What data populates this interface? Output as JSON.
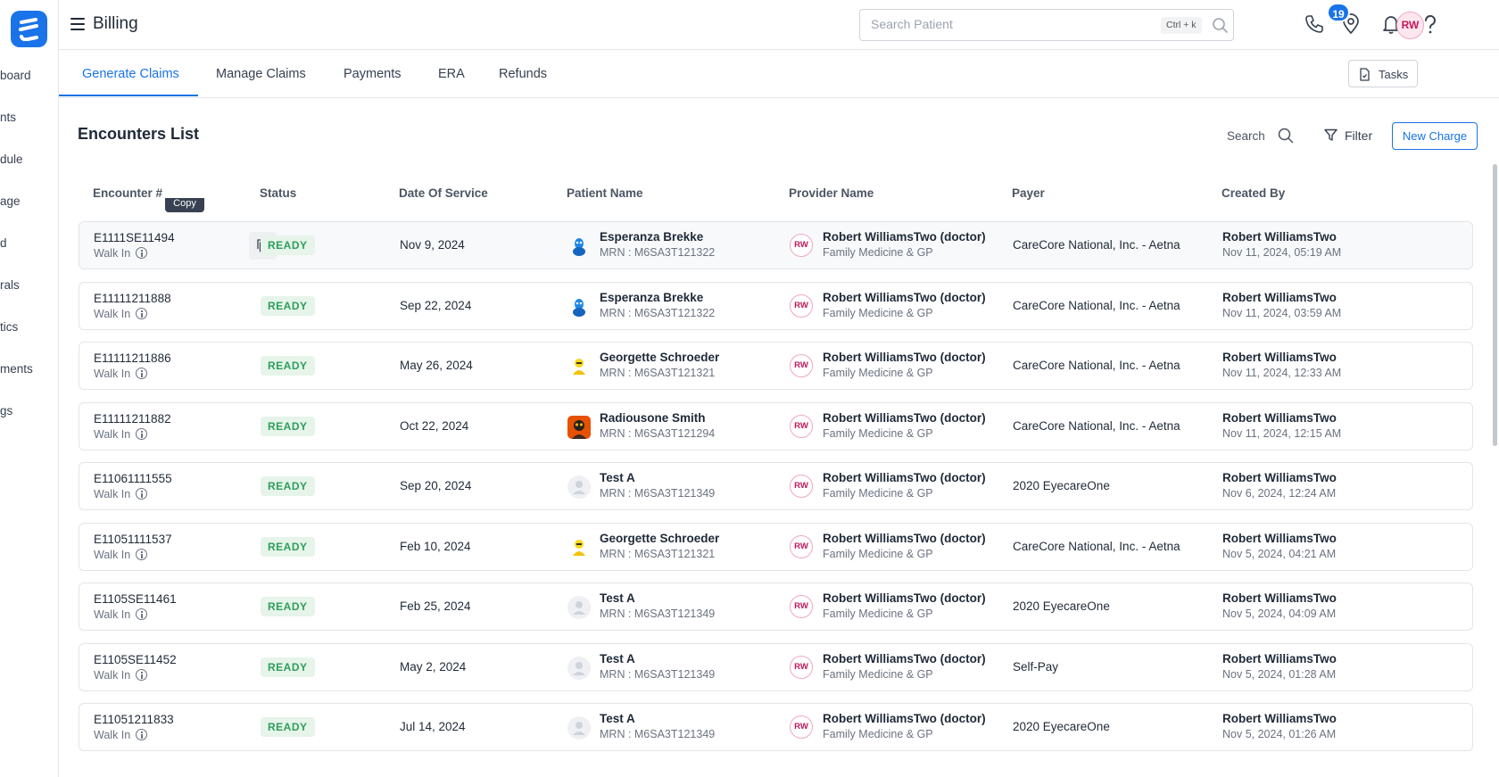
{
  "sidebar": {
    "items": [
      "board",
      "nts",
      "dule",
      "age",
      "d",
      "rals",
      "tics",
      "ments",
      "gs"
    ]
  },
  "header": {
    "title": "Billing",
    "search_placeholder": "Search Patient",
    "shortcut": "Ctrl + k",
    "notification_count": "19",
    "avatar_initials": "RW"
  },
  "tabs": [
    {
      "label": "Generate Claims",
      "active": true
    },
    {
      "label": "Manage Claims",
      "active": false
    },
    {
      "label": "Payments",
      "active": false
    },
    {
      "label": "ERA",
      "active": false
    },
    {
      "label": "Refunds",
      "active": false
    }
  ],
  "tasks_label": "Tasks",
  "list": {
    "title": "Encounters List",
    "search_label": "Search",
    "filter_label": "Filter",
    "new_charge_label": "New Charge",
    "tooltip": "Copy",
    "columns": [
      "Encounter #",
      "Status",
      "Date Of Service",
      "Patient Name",
      "Provider Name",
      "Payer",
      "Created By"
    ],
    "rows": [
      {
        "id": "E1111SE11494",
        "type": "Walk In",
        "status": "READY",
        "dos": "Nov 9, 2024",
        "patient": "Esperanza Brekke",
        "mrn": "MRN : M6SA3T121322",
        "avatar": "blue",
        "provider_initials": "RW",
        "provider": "Robert WilliamsTwo (doctor)",
        "specialty": "Family Medicine & GP",
        "payer": "CareCore National, Inc. - Aetna",
        "creator": "Robert WilliamsTwo",
        "created": "Nov 11, 2024, 05:19 AM"
      },
      {
        "id": "E11111211888",
        "type": "Walk In",
        "status": "READY",
        "dos": "Sep 22, 2024",
        "patient": "Esperanza Brekke",
        "mrn": "MRN : M6SA3T121322",
        "avatar": "blue",
        "provider_initials": "RW",
        "provider": "Robert WilliamsTwo (doctor)",
        "specialty": "Family Medicine & GP",
        "payer": "CareCore National, Inc. - Aetna",
        "creator": "Robert WilliamsTwo",
        "created": "Nov 11, 2024, 03:59 AM"
      },
      {
        "id": "E11111211886",
        "type": "Walk In",
        "status": "READY",
        "dos": "May 26, 2024",
        "patient": "Georgette Schroeder",
        "mrn": "MRN : M6SA3T121321",
        "avatar": "yellow",
        "provider_initials": "RW",
        "provider": "Robert WilliamsTwo (doctor)",
        "specialty": "Family Medicine & GP",
        "payer": "CareCore National, Inc. - Aetna",
        "creator": "Robert WilliamsTwo",
        "created": "Nov 11, 2024, 12:33 AM"
      },
      {
        "id": "E11111211882",
        "type": "Walk In",
        "status": "READY",
        "dos": "Oct 22, 2024",
        "patient": "Radiousone Smith",
        "mrn": "MRN : M6SA3T121294",
        "avatar": "orange",
        "provider_initials": "RW",
        "provider": "Robert WilliamsTwo (doctor)",
        "specialty": "Family Medicine & GP",
        "payer": "CareCore National, Inc. - Aetna",
        "creator": "Robert WilliamsTwo",
        "created": "Nov 11, 2024, 12:15 AM"
      },
      {
        "id": "E11061111555",
        "type": "Walk In",
        "status": "READY",
        "dos": "Sep 20, 2024",
        "patient": "Test A",
        "mrn": "MRN : M6SA3T121349",
        "avatar": "placeholder",
        "provider_initials": "RW",
        "provider": "Robert WilliamsTwo (doctor)",
        "specialty": "Family Medicine & GP",
        "payer": "2020 EyecareOne",
        "creator": "Robert WilliamsTwo",
        "created": "Nov 6, 2024, 12:24 AM"
      },
      {
        "id": "E11051111537",
        "type": "Walk In",
        "status": "READY",
        "dos": "Feb 10, 2024",
        "patient": "Georgette Schroeder",
        "mrn": "MRN : M6SA3T121321",
        "avatar": "yellow",
        "provider_initials": "RW",
        "provider": "Robert WilliamsTwo (doctor)",
        "specialty": "Family Medicine & GP",
        "payer": "CareCore National, Inc. - Aetna",
        "creator": "Robert WilliamsTwo",
        "created": "Nov 5, 2024, 04:21 AM"
      },
      {
        "id": "E1105SE11461",
        "type": "Walk In",
        "status": "READY",
        "dos": "Feb 25, 2024",
        "patient": "Test A",
        "mrn": "MRN : M6SA3T121349",
        "avatar": "placeholder",
        "provider_initials": "RW",
        "provider": "Robert WilliamsTwo (doctor)",
        "specialty": "Family Medicine & GP",
        "payer": "2020 EyecareOne",
        "creator": "Robert WilliamsTwo",
        "created": "Nov 5, 2024, 04:09 AM"
      },
      {
        "id": "E1105SE11452",
        "type": "Walk In",
        "status": "READY",
        "dos": "May 2, 2024",
        "patient": "Test A",
        "mrn": "MRN : M6SA3T121349",
        "avatar": "placeholder",
        "provider_initials": "RW",
        "provider": "Robert WilliamsTwo (doctor)",
        "specialty": "Family Medicine & GP",
        "payer": "Self-Pay",
        "creator": "Robert WilliamsTwo",
        "created": "Nov 5, 2024, 01:28 AM"
      },
      {
        "id": "E11051211833",
        "type": "Walk In",
        "status": "READY",
        "dos": "Jul 14, 2024",
        "patient": "Test A",
        "mrn": "MRN : M6SA3T121349",
        "avatar": "placeholder",
        "provider_initials": "RW",
        "provider": "Robert WilliamsTwo (doctor)",
        "specialty": "Family Medicine & GP",
        "payer": "2020 EyecareOne",
        "creator": "Robert WilliamsTwo",
        "created": "Nov 5, 2024, 01:26 AM"
      }
    ]
  },
  "colors": {
    "accent": "#1a73e8",
    "ready_bg": "#e6f4ea",
    "ready_text": "#2e9e5b",
    "provider_pink": "#c2185b"
  }
}
